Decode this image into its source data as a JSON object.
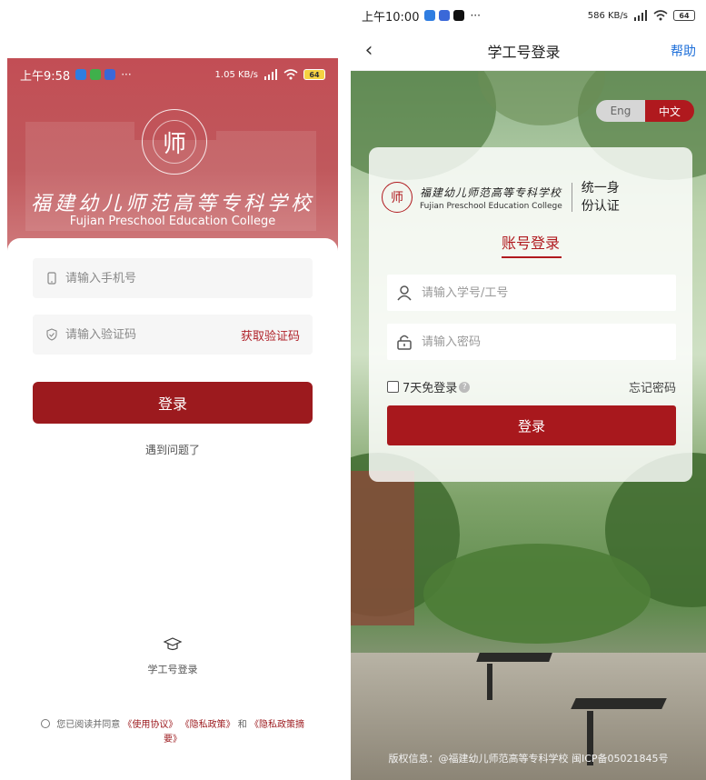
{
  "left": {
    "status": {
      "time": "上午9:58",
      "speed": "1.05 KB/s",
      "signal": "HD",
      "battery": "64"
    },
    "school": {
      "seal_char": "师",
      "name_cn": "福建幼儿师范高等专科学校",
      "name_en": "Fujian Preschool Education College"
    },
    "form": {
      "phone_placeholder": "请输入手机号",
      "code_placeholder": "请输入验证码",
      "get_code_label": "获取验证码",
      "login_label": "登录",
      "help_label": "遇到问题了"
    },
    "staff_login_label": "学工号登录",
    "agreement": {
      "prefix": "您已阅读并同意",
      "terms": "《使用协议》",
      "privacy": "《隐私政策》",
      "and": "和",
      "privacy_summary": "《隐私政策摘要》"
    }
  },
  "right": {
    "status": {
      "time": "上午10:00",
      "speed": "586 KB/s",
      "battery": "64"
    },
    "nav": {
      "back_icon": "‹",
      "title": "学工号登录",
      "help": "帮助"
    },
    "lang": {
      "en": "Eng",
      "zh": "中文"
    },
    "card": {
      "seal_char": "师",
      "name_cn": "福建幼儿师范高等专科学校",
      "name_en": "Fujian Preschool Education College",
      "sso_line1": "统一身",
      "sso_line2": "份认证",
      "tab": "账号登录",
      "user_placeholder": "请输入学号/工号",
      "pwd_placeholder": "请输入密码",
      "remember": "7天免登录",
      "forgot": "忘记密码",
      "login": "登录"
    },
    "copyright": "版权信息：@福建幼儿师范高等专科学校 闽ICP备05021845号"
  },
  "colors": {
    "brand_red": "#9c1a1e",
    "accent_red": "#b0191e",
    "link_blue": "#1e6fd9"
  }
}
